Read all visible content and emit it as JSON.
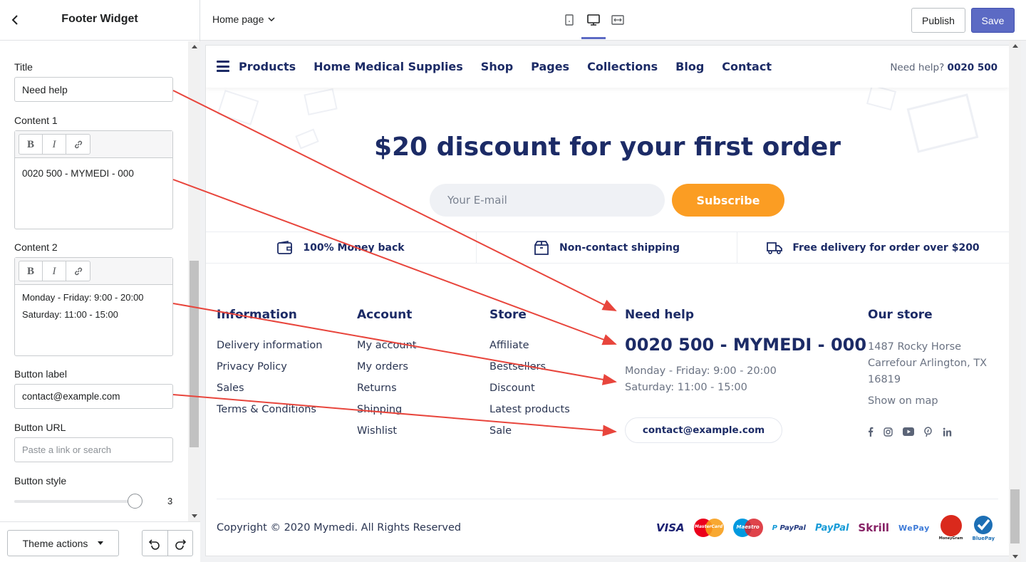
{
  "sidebar": {
    "title": "Footer Widget",
    "fields": {
      "title_label": "Title",
      "title_value": "Need help",
      "content1_label": "Content 1",
      "content1_value": "0020 500 - MYMEDI - 000",
      "content2_label": "Content 2",
      "content2_line1": "Monday - Friday: 9:00 - 20:00",
      "content2_line2": "Saturday: 11:00 - 15:00",
      "button_label_label": "Button label",
      "button_label_value": "contact@example.com",
      "button_url_label": "Button URL",
      "button_url_placeholder": "Paste a link or search",
      "button_style_label": "Button style",
      "button_style_value": "3"
    },
    "rte_buttons": [
      "B",
      "I"
    ],
    "theme_actions": "Theme actions"
  },
  "topbar": {
    "page_selector": "Home page",
    "publish": "Publish",
    "save": "Save",
    "accent": "#5c6ac4"
  },
  "preview": {
    "nav": {
      "items": [
        "Products",
        "Home Medical Supplies",
        "Shop",
        "Pages",
        "Collections",
        "Blog",
        "Contact"
      ],
      "help_label": "Need help?",
      "help_phone": "0020 500"
    },
    "promo": {
      "title": "$20 discount for your first order",
      "email_placeholder": "Your E-mail",
      "subscribe": "Subscribe",
      "button_color": "#fb9d23"
    },
    "features": [
      {
        "icon": "wallet-icon",
        "label": "100% Money back"
      },
      {
        "icon": "box-icon",
        "label": "Non-contact shipping"
      },
      {
        "icon": "truck-icon",
        "label": "Free delivery for order over $200"
      }
    ],
    "footer": {
      "information": {
        "title": "Information",
        "links": [
          "Delivery information",
          "Privacy Policy",
          "Sales",
          "Terms & Conditions"
        ]
      },
      "account": {
        "title": "Account",
        "links": [
          "My account",
          "My orders",
          "Returns",
          "Shipping",
          "Wishlist"
        ]
      },
      "store": {
        "title": "Store",
        "links": [
          "Affiliate",
          "Bestsellers",
          "Discount",
          "Latest products",
          "Sale"
        ]
      },
      "help": {
        "title": "Need help",
        "phone": "0020 500 - MYMEDI - 000",
        "hours1": "Monday - Friday: 9:00 - 20:00",
        "hours2": "Saturday: 11:00 - 15:00",
        "button": "contact@example.com"
      },
      "our_store": {
        "title": "Our store",
        "address": "1487 Rocky Horse Carrefour Arlington, TX 16819",
        "map": "Show on map",
        "socials": [
          "facebook-icon",
          "instagram-icon",
          "youtube-icon",
          "pinterest-icon",
          "linkedin-icon"
        ]
      },
      "copyright": "Copyright © 2020 Mymedi. All Rights Reserved",
      "payments": [
        "VISA",
        "MasterCard",
        "Maestro",
        "PayPal",
        "PayPal",
        "Skrill",
        "WePay",
        "MoneyGram",
        "BluePay"
      ]
    },
    "brand_color": "#1c2b66"
  },
  "annotation_color": "#e8453c"
}
